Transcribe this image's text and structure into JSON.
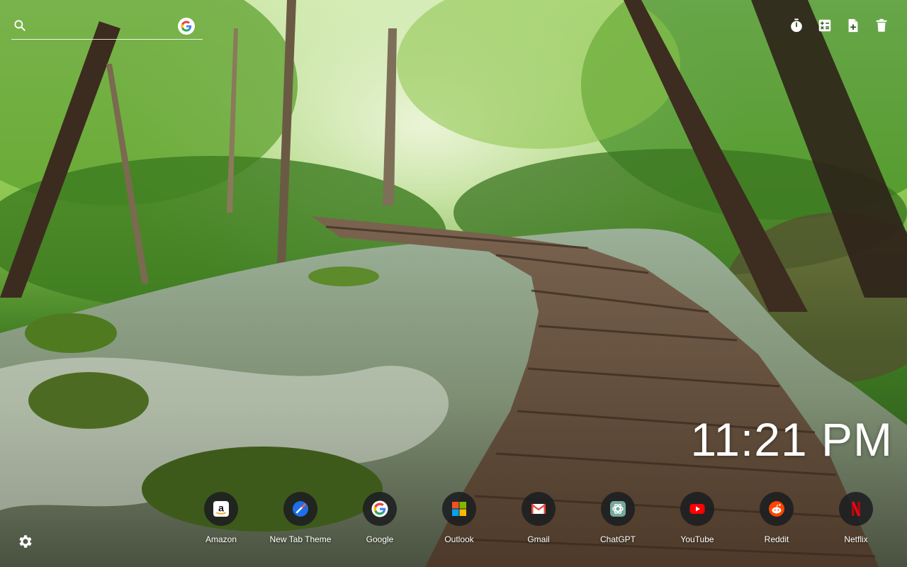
{
  "search": {
    "placeholder": "",
    "engine_icon": "google-g-icon"
  },
  "toolbar": {
    "items": [
      {
        "icon": "timer-icon"
      },
      {
        "icon": "calculator-icon"
      },
      {
        "icon": "new-note-icon"
      },
      {
        "icon": "trash-icon"
      }
    ]
  },
  "clock": {
    "time": "11:21 PM"
  },
  "shortcuts": [
    {
      "label": "Amazon",
      "icon": "amazon-icon"
    },
    {
      "label": "New Tab Theme",
      "icon": "new-tab-theme-icon"
    },
    {
      "label": "Google",
      "icon": "google-icon"
    },
    {
      "label": "Outlook",
      "icon": "outlook-icon"
    },
    {
      "label": "Gmail",
      "icon": "gmail-icon"
    },
    {
      "label": "ChatGPT",
      "icon": "chatgpt-icon"
    },
    {
      "label": "YouTube",
      "icon": "youtube-icon"
    },
    {
      "label": "Reddit",
      "icon": "reddit-icon"
    },
    {
      "label": "Netflix",
      "icon": "netflix-icon"
    }
  ],
  "settings": {
    "icon": "gear-icon"
  },
  "colors": {
    "dock_circle": "#1c1e21",
    "youtube_red": "#ff0000",
    "reddit_orange": "#ff4500",
    "netflix_red": "#e50914",
    "gmail_red": "#ea4335"
  }
}
